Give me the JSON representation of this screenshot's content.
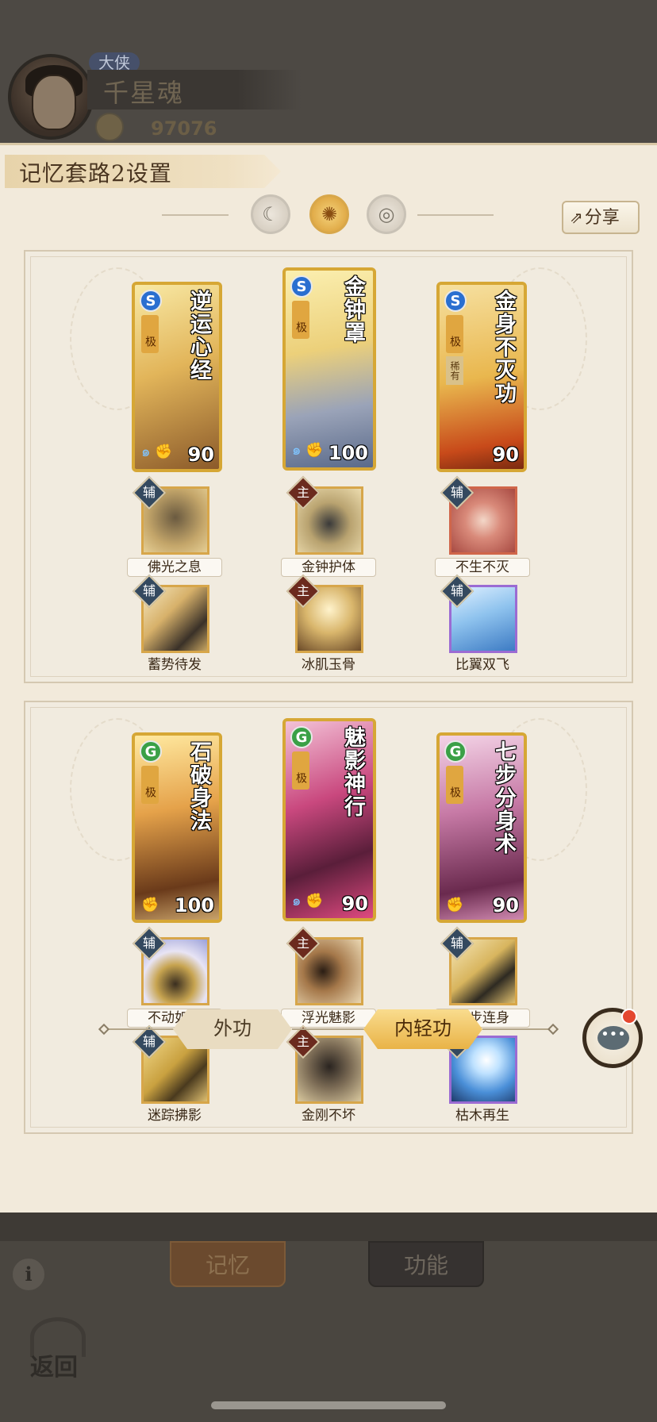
{
  "header": {
    "rank_badge": "大侠",
    "player_name": "千星魂",
    "power_value": "97076"
  },
  "panel": {
    "title": "记忆套路2设置",
    "share_label": "分享",
    "slots": [
      "slot-1",
      "slot-2",
      "slot-3"
    ],
    "active_slot": 2
  },
  "groups": [
    {
      "cards": [
        {
          "name": "逆运心经",
          "type": "S",
          "grade": "极",
          "level": "90",
          "rare": ""
        },
        {
          "name": "金钟罩",
          "type": "S",
          "grade": "极",
          "level": "100",
          "rare": ""
        },
        {
          "name": "金身不灭功",
          "type": "S",
          "grade": "极",
          "level": "90",
          "rare": "稀有"
        }
      ],
      "skills_row1": [
        {
          "label": "佛光之息",
          "role": "辅"
        },
        {
          "label": "金钟护体",
          "role": "主"
        },
        {
          "label": "不生不灭",
          "role": "辅"
        }
      ],
      "skills_row2": [
        {
          "label": "蓄势待发",
          "role": "辅"
        },
        {
          "label": "冰肌玉骨",
          "role": "主"
        },
        {
          "label": "比翼双飞",
          "role": "辅"
        }
      ]
    },
    {
      "cards": [
        {
          "name": "石破身法",
          "type": "G",
          "grade": "极",
          "level": "100"
        },
        {
          "name": "魅影神行",
          "type": "G",
          "grade": "极",
          "level": "90"
        },
        {
          "name": "七步分身术",
          "type": "G",
          "grade": "极",
          "level": "90"
        }
      ],
      "skills_row1": [
        {
          "label": "不动如山",
          "role": "辅"
        },
        {
          "label": "浮光魅影",
          "role": "主"
        },
        {
          "label": "七步连身",
          "role": "辅"
        }
      ],
      "skills_row2": [
        {
          "label": "迷踪拂影",
          "role": "辅"
        },
        {
          "label": "金刚不坏",
          "role": "主"
        },
        {
          "label": "枯木再生",
          "role": "辅"
        }
      ]
    }
  ],
  "tabs": {
    "outer": "外功",
    "inner": "内轻功",
    "active": "inner"
  },
  "bottom": {
    "memory_tab": "记忆",
    "function_tab": "功能",
    "info_icon": "i",
    "back_label": "返回"
  },
  "colors": {
    "panel_bg": "#f2eadb",
    "gold_frame": "#d6a735",
    "active_tab": "#e9b347",
    "notification": "#e4472f"
  }
}
